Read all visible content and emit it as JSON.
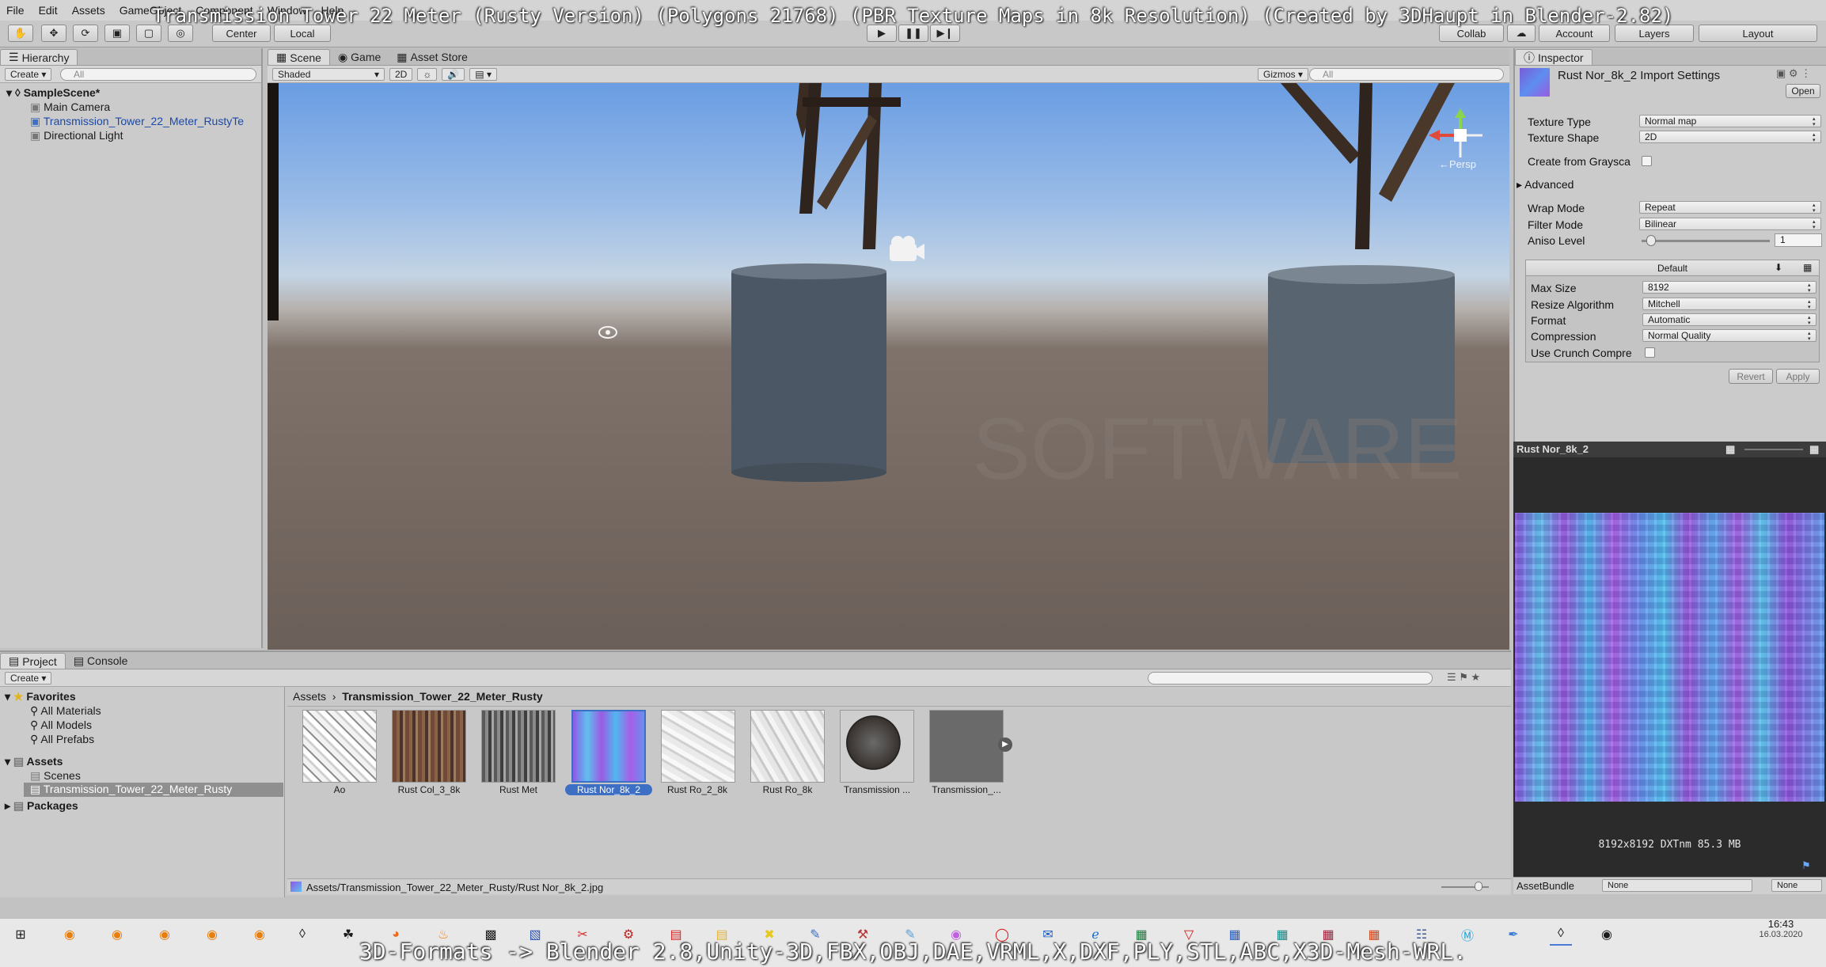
{
  "video_overlay": {
    "title": "Transmission Tower 22 Meter (Rusty Version) (Polygons 21768) (PBR Texture Maps in 8k Resolution) (Created by 3DHaupt in Blender-2.82)",
    "footer": "3D-Formats -> Blender 2.8,Unity-3D,FBX,OBJ,DAE,VRML,X,DXF,PLY,STL,ABC,X3D-Mesh-WRL."
  },
  "menu": [
    "File",
    "Edit",
    "Assets",
    "GameObject",
    "Component",
    "Window",
    "Help"
  ],
  "toolbar": {
    "center": "Center",
    "local": "Local",
    "collab": "Collab",
    "account": "Account",
    "layers": "Layers",
    "layout": "Layout"
  },
  "hierarchy": {
    "tab": "Hierarchy",
    "create": "Create",
    "search_placeholder": "All",
    "scene": "SampleScene*",
    "items": [
      "Main Camera",
      "Transmission_Tower_22_Meter_RustyTe",
      "Directional Light"
    ]
  },
  "scene_view": {
    "tabs": [
      "Scene",
      "Game",
      "Asset Store"
    ],
    "shading": "Shaded",
    "mode_2d": "2D",
    "gizmos": "Gizmos",
    "search_placeholder": "All",
    "persp": "←Persp",
    "watermark": "SOFTWARE"
  },
  "inspector": {
    "tab": "Inspector",
    "title": "Rust Nor_8k_2 Import Settings",
    "open": "Open",
    "fields": {
      "texture_type_label": "Texture Type",
      "texture_type": "Normal map",
      "texture_shape_label": "Texture Shape",
      "texture_shape": "2D",
      "create_from_grayscale": "Create from Graysca",
      "advanced": "Advanced",
      "wrap_mode_label": "Wrap Mode",
      "wrap_mode": "Repeat",
      "filter_mode_label": "Filter Mode",
      "filter_mode": "Bilinear",
      "aniso_level_label": "Aniso Level",
      "aniso_level": "1"
    },
    "platform": {
      "tab": "Default",
      "max_size_label": "Max Size",
      "max_size": "8192",
      "resize_algorithm_label": "Resize Algorithm",
      "resize_algorithm": "Mitchell",
      "format_label": "Format",
      "format": "Automatic",
      "compression_label": "Compression",
      "compression": "Normal Quality",
      "crunch_label": "Use Crunch Compre"
    },
    "revert": "Revert",
    "apply": "Apply"
  },
  "preview": {
    "title": "Rust Nor_8k_2",
    "info": "8192x8192  DXTnm  85.3 MB",
    "assetbundle_label": "AssetBundle",
    "assetbundle_value": "None",
    "variant_value": "None"
  },
  "project": {
    "tabs": [
      "Project",
      "Console"
    ],
    "create": "Create",
    "breadcrumb_root": "Assets",
    "breadcrumb_folder": "Transmission_Tower_22_Meter_Rusty",
    "favorites": {
      "label": "Favorites",
      "items": [
        "All Materials",
        "All Models",
        "All Prefabs"
      ]
    },
    "assets": {
      "label": "Assets",
      "items": [
        "Scenes",
        "Transmission_Tower_22_Meter_Rusty"
      ]
    },
    "packages": "Packages",
    "thumbnails": [
      "Ao",
      "Rust Col_3_8k",
      "Rust Met",
      "Rust Nor_8k_2",
      "Rust Ro_2_8k",
      "Rust Ro_8k",
      "Transmission ...",
      "Transmission_..."
    ],
    "status_path": "Assets/Transmission_Tower_22_Meter_Rusty/Rust Nor_8k_2.jpg"
  },
  "taskbar": {
    "time": "16:43",
    "date": "16.03.2020"
  },
  "colors": {
    "selection": "#3d6fc4",
    "normal_map_purple": "#8a4fe0",
    "normal_map_cyan": "#4fb8f0"
  }
}
